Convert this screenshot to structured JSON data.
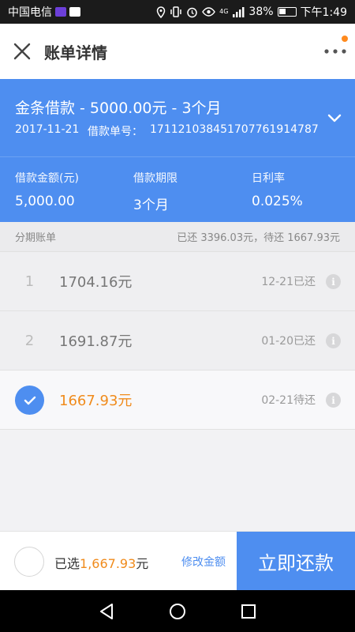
{
  "status_bar": {
    "carrier": "中国电信",
    "battery_percent": "38%",
    "time": "下午1:49",
    "signal_label": "4G"
  },
  "app_bar": {
    "title": "账单详情",
    "close_icon": "close-icon",
    "more_icon": "more-horizontal-icon",
    "notification_dot_color": "#ff8a1e"
  },
  "loan": {
    "title": "金条借款 - 5000.00元 - 3个月",
    "date": "2017-11-21",
    "number_label": "借款单号：",
    "number": "17112103845170776191478 7",
    "stats": [
      {
        "label": "借款金额(元)",
        "value": "5,000.00"
      },
      {
        "label": "借款期限",
        "value": "3个月"
      },
      {
        "label": "日利率",
        "value": "0.025%"
      }
    ]
  },
  "installments": {
    "section_title": "分期账单",
    "summary": "已还 3396.03元，待还 1667.93元",
    "rows": [
      {
        "index": "1",
        "amount": "1704.16元",
        "status": "12-21已还",
        "selected": false
      },
      {
        "index": "2",
        "amount": "1691.87元",
        "status": "01-20已还",
        "selected": false
      },
      {
        "index": "",
        "amount": "1667.93元",
        "status": "02-21待还",
        "selected": true
      }
    ]
  },
  "action_bar": {
    "selected_prefix": "已选",
    "selected_amount": "1,667.93",
    "selected_suffix": "元",
    "edit_label": "修改金额",
    "pay_label": "立即还款"
  },
  "colors": {
    "brand_blue": "#4e8ef0",
    "accent_orange": "#f08b1c"
  }
}
